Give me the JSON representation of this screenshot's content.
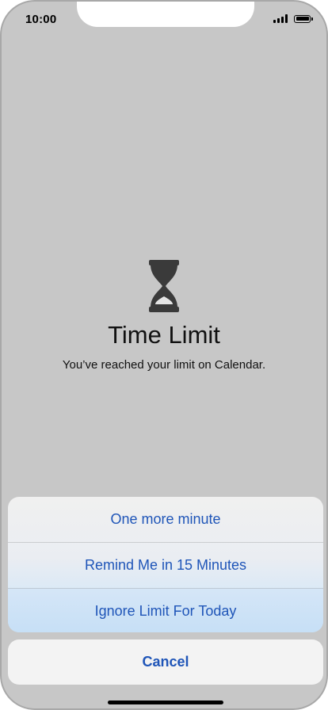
{
  "status_bar": {
    "time": "10:00",
    "icons": [
      "cellular-signal-icon",
      "battery-icon"
    ]
  },
  "alert": {
    "icon": "hourglass-icon",
    "title": "Time Limit",
    "message": "You’ve reached your limit on Calendar."
  },
  "action_sheet": {
    "options": [
      {
        "label": "One more minute"
      },
      {
        "label": "Remind Me in 15 Minutes"
      },
      {
        "label": "Ignore Limit For Today"
      }
    ],
    "cancel_label": "Cancel"
  },
  "colors": {
    "background": "#c7c7c7",
    "action_text": "#1f55b8",
    "icon": "#3a3a3a"
  }
}
